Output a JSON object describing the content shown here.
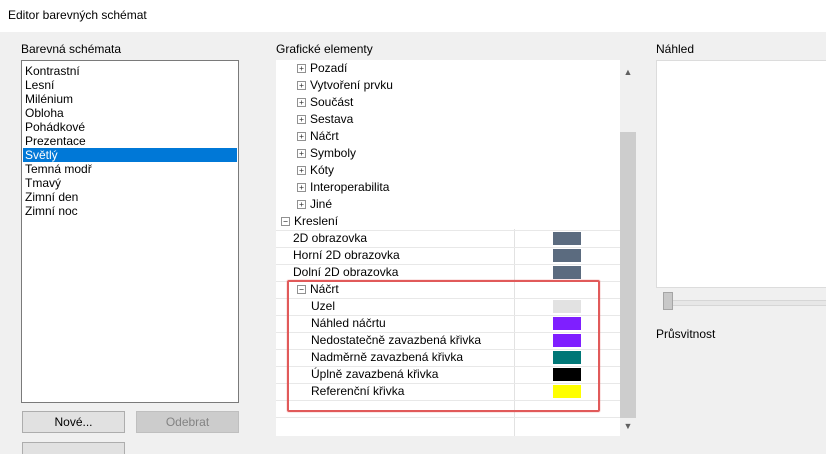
{
  "window": {
    "title": "Editor barevných schémat"
  },
  "schemes": {
    "label": "Barevná schémata",
    "items": [
      "Kontrastní",
      "Lesní",
      "Milénium",
      "Obloha",
      "Pohádkové",
      "Prezentace",
      "Světlý",
      "Temná modř",
      "Tmavý",
      "Zimní den",
      "Zimní noc"
    ],
    "selected": "Světlý",
    "new_button": "Nové...",
    "remove_button": "Odebrat"
  },
  "elements": {
    "label": "Grafické elementy",
    "top_nodes": [
      "Pozadí",
      "Vytvoření prvku",
      "Součást",
      "Sestava",
      "Náčrt",
      "Symboly",
      "Kóty",
      "Interoperabilita",
      "Jiné"
    ],
    "drawing_group": "Kreslení",
    "drawing_rows": [
      {
        "label": "2D obrazovka",
        "color": "#5b6b7f"
      },
      {
        "label": "Horní 2D obrazovka",
        "color": "#5b6b7f"
      },
      {
        "label": "Dolní 2D obrazovka",
        "color": "#5b6b7f"
      }
    ],
    "sketch_group": "Náčrt",
    "sketch_rows": [
      {
        "label": "Uzel",
        "color": "#e2e2e2"
      },
      {
        "label": "Náhled náčrtu",
        "color": "#7f1fff"
      },
      {
        "label": "Nedostatečně zavazbená křivka",
        "color": "#7f1fff"
      },
      {
        "label": "Nadměrně zavazbená křivka",
        "color": "#007777"
      },
      {
        "label": "Úplně zavazbená křivka",
        "color": "#000000"
      },
      {
        "label": "Referenční křivka",
        "color": "#ffff00"
      }
    ]
  },
  "preview": {
    "label": "Náhled",
    "transparency_label": "Průsvitnost"
  },
  "icons": {
    "expand": "⊞",
    "collapse": "⊟",
    "scroll_up": "▲",
    "scroll_down": "▼"
  }
}
